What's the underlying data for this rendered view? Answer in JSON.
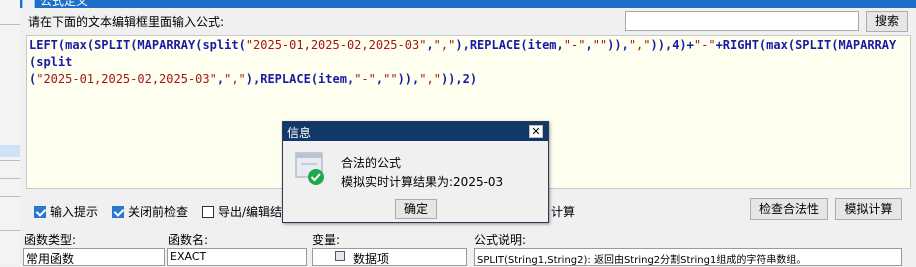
{
  "window": {
    "title": "公式定义"
  },
  "prompt": "请在下面的文本编辑框里面输入公式:",
  "search": {
    "value": "",
    "button_label": "搜索"
  },
  "formula": {
    "line1": "LEFT(max(SPLIT(MAPARRAY(split(\"2025-01,2025-02,2025-03\",\",\"),REPLACE(item,\"-\",\"\")),\",\")),4)+\"-\"+RIGHT(max(SPLIT(MAPARRAY(split",
    "line2": "(\"2025-01,2025-02,2025-03\",\",\"),REPLACE(item,\"-\",\"\")),\",\")),2)"
  },
  "options": {
    "hint_label": "输入提示",
    "hint_checked": true,
    "check_before_close_label": "关闭前检查",
    "check_before_close_checked": true,
    "export_label": "导出/编辑结",
    "export_checked": false,
    "partial_calc_label": "计算"
  },
  "buttons": {
    "check_validity": "检查合法性",
    "simulate_calc": "模拟计算"
  },
  "bottom": {
    "func_type_label": "函数类型:",
    "func_type_value": "常用函数",
    "func_name_label": "函数名:",
    "func_name_value": "EXACT",
    "variable_label": "变量:",
    "variable_item": "数据项",
    "desc_label": "公式说明:",
    "desc_text": "SPLIT(String1,String2): 返回由String2分割String1组成的字符串数组。"
  },
  "info_dialog": {
    "title": "信息",
    "close": "✕",
    "message1": "合法的公式",
    "message2": "模拟实时计算结果为:2025-03",
    "ok_label": "确定"
  },
  "colors": {
    "titlebar": "#1e6fc7",
    "info_titlebar": "#12386a",
    "editor_bg": "#fffff0",
    "keyword": "#1a1aa6",
    "string": "#a31515",
    "checkbox": "#2b76d2"
  }
}
